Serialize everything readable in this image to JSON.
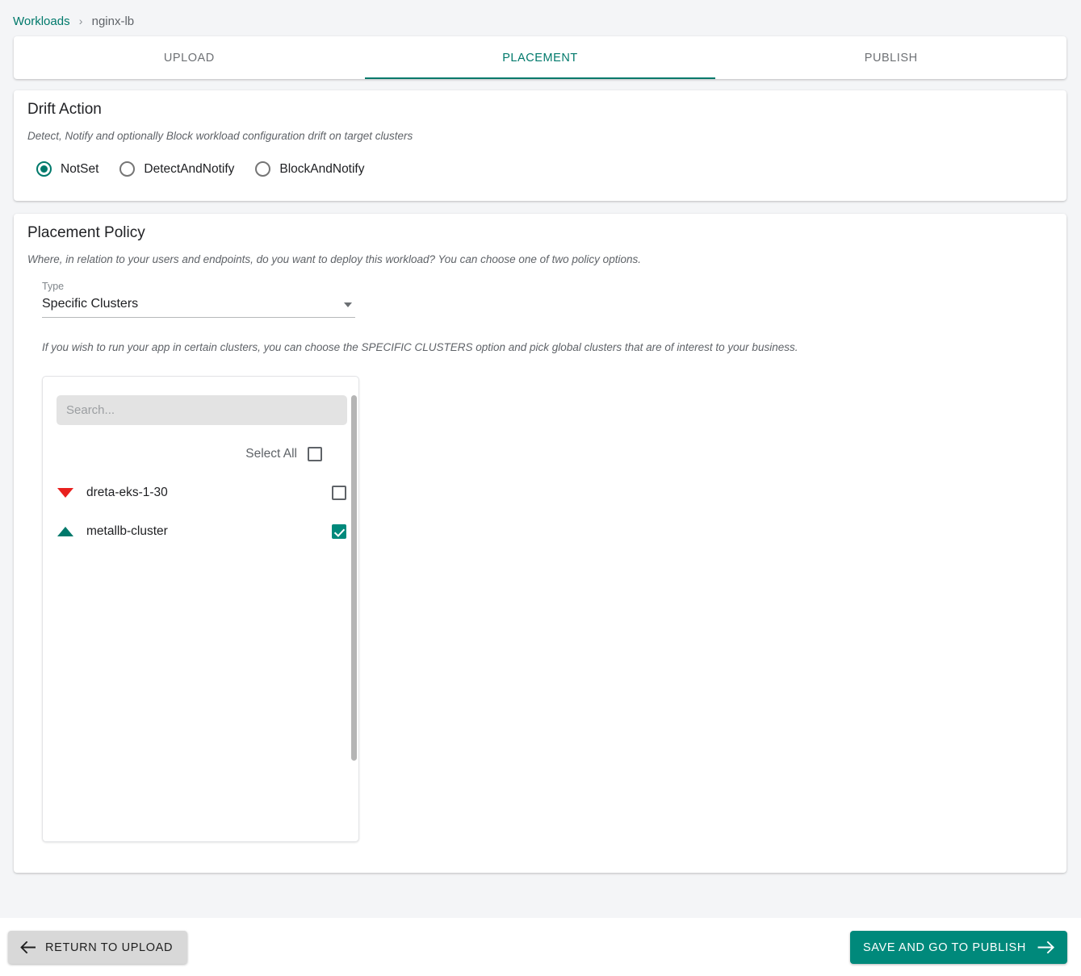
{
  "breadcrumb": {
    "parent": "Workloads",
    "separator": "›",
    "current": "nginx-lb"
  },
  "tabs": [
    {
      "label": "UPLOAD",
      "active": false
    },
    {
      "label": "PLACEMENT",
      "active": true
    },
    {
      "label": "PUBLISH",
      "active": false
    }
  ],
  "drift_action": {
    "title": "Drift Action",
    "subtitle": "Detect, Notify and optionally Block workload configuration drift on target clusters",
    "options": [
      {
        "label": "NotSet",
        "selected": true
      },
      {
        "label": "DetectAndNotify",
        "selected": false
      },
      {
        "label": "BlockAndNotify",
        "selected": false
      }
    ]
  },
  "placement_policy": {
    "title": "Placement Policy",
    "subtitle": "Where, in relation to your users and endpoints, do you want to deploy this workload? You can choose one of two policy options.",
    "type_label": "Type",
    "type_value": "Specific Clusters",
    "hint": "If you wish to run your app in certain clusters, you can choose the SPECIFIC CLUSTERS option and pick global clusters that are of interest to your business.",
    "cluster_picker": {
      "search_placeholder": "Search...",
      "search_value": "",
      "select_all_label": "Select All",
      "select_all_checked": false,
      "clusters": [
        {
          "name": "dreta-eks-1-30",
          "status": "down",
          "checked": false
        },
        {
          "name": "metallb-cluster",
          "status": "up",
          "checked": true
        }
      ]
    }
  },
  "footer": {
    "back_label": "RETURN TO UPLOAD",
    "next_label": "SAVE AND GO TO PUBLISH"
  },
  "colors": {
    "accent_teal": "#00796b",
    "checkbox_teal": "#00897b",
    "status_down_red": "#e8201e",
    "page_bg": "#f4f5f7"
  }
}
